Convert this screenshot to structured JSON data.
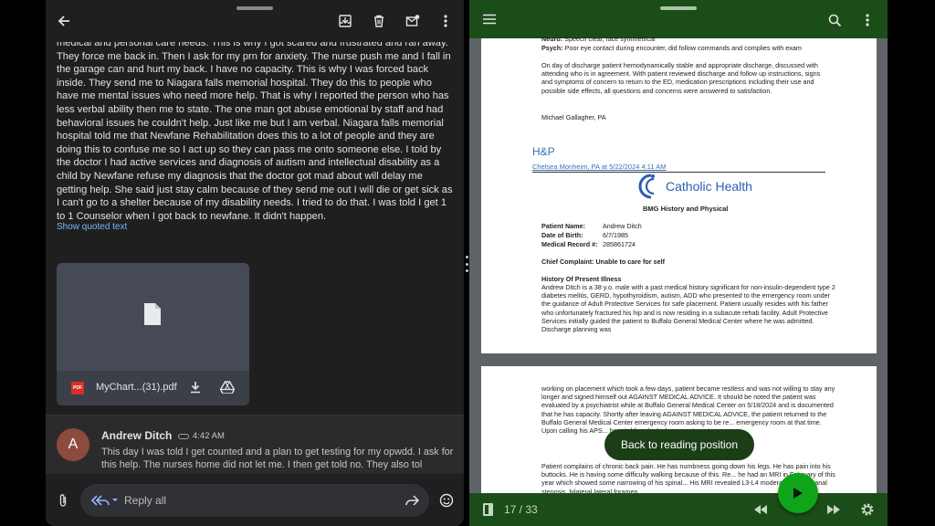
{
  "email": {
    "body_text": "medical and personal care needs. This is why I got scared and frustrated and ran away. They force me back in. Then I ask for my prn for anxiety. The nurse push me and I fall in the garage can and hurt my back. I have no capacity. This is why I was forced back inside. They send me to Niagara falls memorial hospital. They do this to people who have me mental issues who need more help. That is why I reported the person who has less verbal ability then me to state. The one man got abuse emotional by staff and had behavioral issues he couldn't help. Just like me but I am verbal. Niagara falls memorial hospital told me that Newfane Rehabilitation does this to a lot of people and they are doing this to confuse me so I act up so they can pass me onto someone else. I told by the doctor I had active services and diagnosis of autism and intellectual disability as a child by Newfane refuse my diagnosis that the doctor got mad about will delay me getting help. She said just stay calm because of they send me out I will die or get sick as I can't go to a shelter because of my disability needs. I tried to do that. I was told I get 1 to 1 Counselor when I got back to newfane. It didn't happen.",
    "show_quoted": "Show quoted text",
    "attachment_name": "MyChart...(31).pdf",
    "attachment_badge": "PDF",
    "sender": "Andrew Ditch",
    "time": "4:42 AM",
    "avatar_letter": "A",
    "preview": "This day I was told I get counted and a plan to get testing for my opwdd. I ask for this help. The nurses home did not let me. I then get told no. They also tol",
    "reply_label": "Reply all"
  },
  "doc": {
    "neuro_label": "Neuro:",
    "neuro_text": "Speech clear, face symmetrical",
    "psych_label": "Psych:",
    "psych_text": "Poor eye contact during encounter, did follow commands and complies with exam",
    "discharge_text": "On day of discharge patient hemodynamically stable and appropriate discharge, discussed with attending who is in agreement. With patient reviewed discharge and follow up instructions, signs and symptoms of concern to return to the ED, medication prescriptions including their use and possible side effects, all questions and concerns were answered to satisfaction.",
    "signer": "Michael Gallagher, PA",
    "hp_title": "H&P",
    "hp_author": "Chelsea Monheim, PA at 5/22/2024 4:11 AM",
    "logo_text": "Catholic Health",
    "form_title": "BMG History and Physical",
    "patient_name_label": "Patient Name:",
    "patient_name": "Andrew Ditch",
    "dob_label": "Date of Birth:",
    "dob": "6/7/1985",
    "mrn_label": "Medical Record #:",
    "mrn": "285861724",
    "chief_complaint": "Chief Complaint: Unable to care for self",
    "hpi_title": "History Of Present Illness",
    "hpi_text": "Andrew Ditch is a 38 y.o. male with a past medical history significant for non-insulin-dependent type 2 diabetes melitis, GERD, hypothyroidism, autism, ADD who presented to the emergency room under the guidance of Adult Protective Services for safe placement. Patient usually resides with his father who unfortunately fractured his hip and is now residing in a subacute rehab facility.  Adult Protective Services initially guided the patient to Buffalo General Medical Center where he was admitted.  Discharge planning was",
    "page2_text": "working on placement which took a few days, patient became restless and was not willing to stay any longer and signed himself out AGAINST MEDICAL ADVICE.  It should be noted the patient was evaluated by a psychiatrist while at Buffalo General Medical Center on 5/18/2024 and is documented that he has capacity.  Shortly after leaving AGAINST MEDICAL ADVICE, the patient returned to the Buffalo General Medical Center emergency room asking to be re... emergency room at that time. Upon calling his APS... hospital for which she came to sisters...",
    "page2_text_b": "Patient complains of chronic back pain.  He has numbness going down his legs.  He has pain into his buttocks.  He is having some difficulty walking because of this.  Re... he had an MRI in February of this year which showed some narrowing of his spinal... His MRI revealed L3-L4 moderate central canal stenosis, bilateral lateral foramen...",
    "toast": "Back to reading position",
    "page_indicator": "17 / 33"
  },
  "colors": {
    "email_bg": "#1f1f1f",
    "viewer_bar": "#1b4d18",
    "fab": "#0ea51a",
    "link_blue": "#7fb0ff"
  }
}
